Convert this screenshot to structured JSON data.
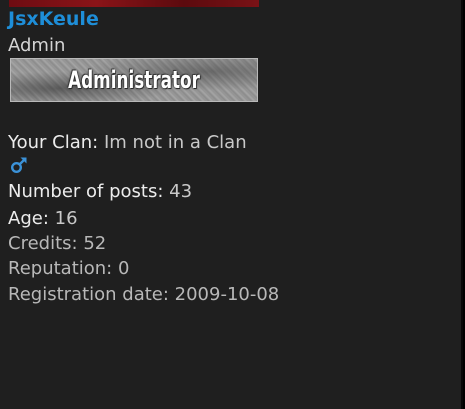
{
  "profile": {
    "username": "JsxKeule",
    "role": "Admin",
    "rank_badge_text": "Administrator",
    "gender_icon": "male-symbol-icon",
    "accent_color": "#1e8ed8",
    "fields": {
      "clan_label": "Your Clan:",
      "clan_value": "Im not in a Clan",
      "posts_label": "Number of posts:",
      "posts_value": "43",
      "age_label": "Age:",
      "age_value": "16",
      "credits_label": "Credits:",
      "credits_value": "52",
      "reputation_label": "Reputation:",
      "reputation_value": "0",
      "registration_label": "Registration date:",
      "registration_value": "2009-10-08"
    }
  }
}
